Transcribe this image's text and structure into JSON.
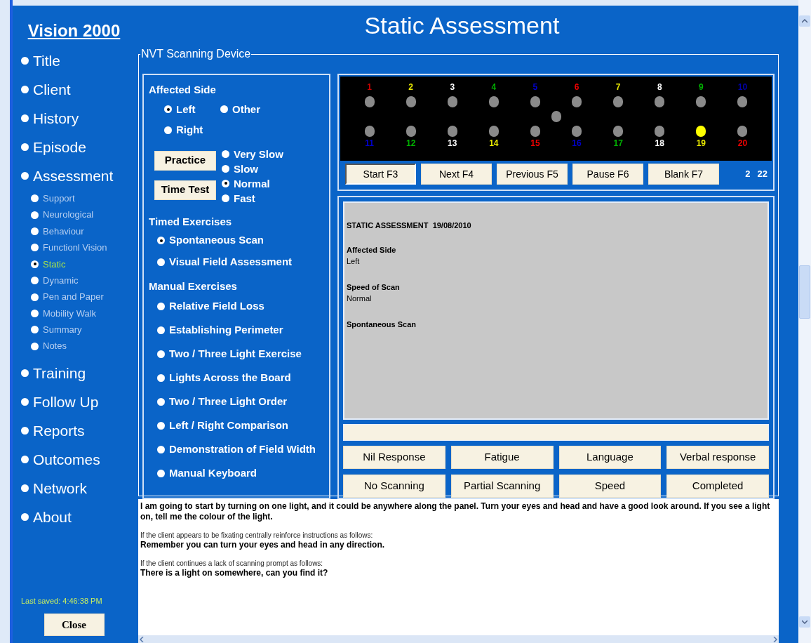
{
  "sidebar": {
    "title": "Vision 2000",
    "items": [
      {
        "label": "Title",
        "selected": false
      },
      {
        "label": "Client",
        "selected": false
      },
      {
        "label": "History",
        "selected": false
      },
      {
        "label": "Episode",
        "selected": false
      },
      {
        "label": "Assessment",
        "selected": false,
        "children": [
          {
            "label": "Support",
            "selected": false
          },
          {
            "label": "Neurological",
            "selected": false
          },
          {
            "label": "Behaviour",
            "selected": false
          },
          {
            "label": "Functionl Vision",
            "selected": false
          },
          {
            "label": "Static",
            "selected": true
          },
          {
            "label": "Dynamic",
            "selected": false
          },
          {
            "label": "Pen and Paper",
            "selected": false
          },
          {
            "label": "Mobility Walk",
            "selected": false
          },
          {
            "label": "Summary",
            "selected": false
          },
          {
            "label": "Notes",
            "selected": false
          }
        ]
      },
      {
        "label": "Training",
        "selected": false
      },
      {
        "label": "Follow Up",
        "selected": false
      },
      {
        "label": "Reports",
        "selected": false
      },
      {
        "label": "Outcomes",
        "selected": false
      },
      {
        "label": "Network",
        "selected": false
      },
      {
        "label": "About",
        "selected": false
      }
    ],
    "last_saved": "Last saved: 4:46:38 PM",
    "close_button": "Close"
  },
  "header": {
    "title": "Static Assessment"
  },
  "device": {
    "legend": "NVT Scanning Device",
    "affected_side": {
      "label": "Affected Side",
      "options": [
        {
          "label": "Left",
          "selected": true
        },
        {
          "label": "Other",
          "selected": false
        },
        {
          "label": "Right",
          "selected": false
        }
      ]
    },
    "practice_button": "Practice",
    "time_test_button": "Time Test",
    "speeds": [
      {
        "label": "Very Slow",
        "selected": false
      },
      {
        "label": "Slow",
        "selected": false
      },
      {
        "label": "Normal",
        "selected": true
      },
      {
        "label": "Fast",
        "selected": false
      }
    ],
    "timed_exercises": {
      "label": "Timed Exercises",
      "options": [
        {
          "label": "Spontaneous Scan",
          "selected": true
        },
        {
          "label": "Visual Field Assessment",
          "selected": false
        }
      ]
    },
    "manual_exercises": {
      "label": "Manual Exercises",
      "options": [
        {
          "label": "Relative Field Loss",
          "selected": false
        },
        {
          "label": "Establishing Perimeter",
          "selected": false
        },
        {
          "label": "Two / Three Light Exercise",
          "selected": false
        },
        {
          "label": "Lights Across the Board",
          "selected": false
        },
        {
          "label": "Two / Three Light Order",
          "selected": false
        },
        {
          "label": "Left / Right Comparison",
          "selected": false
        },
        {
          "label": "Demonstration of Field Width",
          "selected": false
        },
        {
          "label": "Manual Keyboard",
          "selected": false
        }
      ]
    },
    "lights": [
      {
        "label": "1",
        "color": "#cc0000",
        "on": false
      },
      {
        "label": "2",
        "color": "#e8e800",
        "on": false
      },
      {
        "label": "3",
        "color": "#ffffff",
        "on": false
      },
      {
        "label": "4",
        "color": "#00b000",
        "on": false
      },
      {
        "label": "5",
        "color": "#0000cc",
        "on": false
      },
      {
        "label": "6",
        "color": "#ee0000",
        "on": false
      },
      {
        "label": "7",
        "color": "#e8e800",
        "on": false
      },
      {
        "label": "8",
        "color": "#ffffff",
        "on": false
      },
      {
        "label": "9",
        "color": "#00b000",
        "on": false
      },
      {
        "label": "10",
        "color": "#0000aa",
        "on": false
      },
      {
        "label": "11",
        "color": "#0000cc",
        "on": false
      },
      {
        "label": "12",
        "color": "#00b000",
        "on": false
      },
      {
        "label": "13",
        "color": "#ffffff",
        "on": false
      },
      {
        "label": "14",
        "color": "#e8e800",
        "on": false
      },
      {
        "label": "15",
        "color": "#ee0000",
        "on": false
      },
      {
        "label": "16",
        "color": "#0000cc",
        "on": false
      },
      {
        "label": "17",
        "color": "#00b000",
        "on": false
      },
      {
        "label": "18",
        "color": "#ffffff",
        "on": false
      },
      {
        "label": "19",
        "color": "#e8e800",
        "on": true
      },
      {
        "label": "20",
        "color": "#ee0000",
        "on": false
      }
    ],
    "center_light": {
      "on": false
    },
    "controls": [
      {
        "label": "Start F3",
        "selected": true
      },
      {
        "label": "Next F4",
        "selected": false
      },
      {
        "label": "Previous F5",
        "selected": false
      },
      {
        "label": "Pause F6",
        "selected": false
      },
      {
        "label": "Blank F7",
        "selected": false
      }
    ],
    "counters": [
      "2",
      "22"
    ],
    "report": {
      "lines": [
        {
          "kind": "title",
          "text": "STATIC ASSESSMENT  19/08/2010"
        },
        {
          "kind": "heading",
          "text": "Affected Side"
        },
        {
          "kind": "value",
          "text": "Left"
        },
        {
          "kind": "heading",
          "text": "Speed of Scan"
        },
        {
          "kind": "value",
          "text": "Normal"
        },
        {
          "kind": "heading",
          "text": "Spontaneous Scan"
        }
      ]
    },
    "responses": [
      "Nil Response",
      "Fatigue",
      "Language",
      "Verbal response",
      "No Scanning",
      "Partial Scanning",
      "Speed",
      "Completed"
    ]
  },
  "instructions": [
    {
      "kind": "prompt",
      "text": "I am going to start by turning on one light, and it could be anywhere along the panel.  Turn your eyes and head and have a good look around.  If you see a light on, tell me the colour of the light."
    },
    {
      "kind": "note",
      "text": "If the client appears to be fixating centrally reinforce instructions as follows:"
    },
    {
      "kind": "prompt",
      "text": "Remember you can turn your eyes and head in any direction."
    },
    {
      "kind": "note",
      "text": "If the client continues a lack of scanning prompt as follows:"
    },
    {
      "kind": "prompt",
      "text": "There is a light on somewhere, can you find it?"
    }
  ]
}
